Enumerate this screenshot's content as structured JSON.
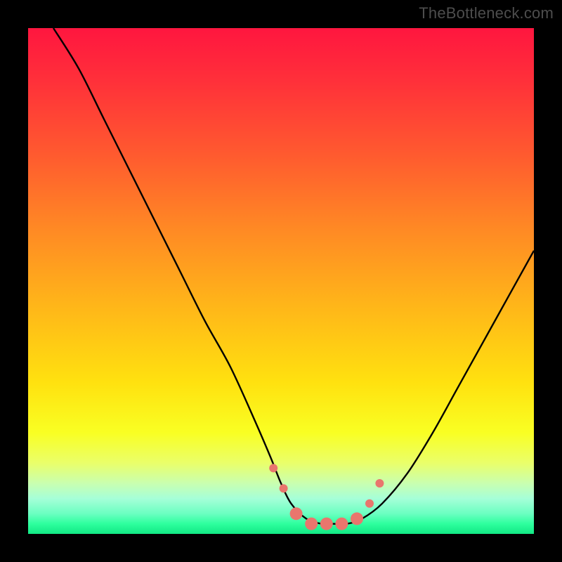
{
  "watermark": "TheBottleneck.com",
  "chart_data": {
    "type": "line",
    "title": "",
    "xlabel": "",
    "ylabel": "",
    "xlim": [
      0,
      100
    ],
    "ylim": [
      0,
      100
    ],
    "grid": false,
    "series": [
      {
        "name": "bottleneck-curve",
        "color": "#000000",
        "x": [
          5,
          10,
          15,
          20,
          25,
          30,
          35,
          40,
          45,
          48,
          50,
          52,
          55,
          58,
          60,
          63,
          66,
          70,
          75,
          80,
          85,
          90,
          95,
          100
        ],
        "y": [
          100,
          92,
          82,
          72,
          62,
          52,
          42,
          33,
          22,
          15,
          10,
          6,
          3,
          2,
          2,
          2,
          3,
          6,
          12,
          20,
          29,
          38,
          47,
          56
        ]
      }
    ],
    "markers": {
      "name": "highlight-dots",
      "color": "#e9766d",
      "radius_small": 6,
      "radius_large": 9,
      "points": [
        {
          "x": 48.5,
          "y": 13,
          "r": "small"
        },
        {
          "x": 50.5,
          "y": 9,
          "r": "small"
        },
        {
          "x": 53.0,
          "y": 4,
          "r": "large"
        },
        {
          "x": 56.0,
          "y": 2,
          "r": "large"
        },
        {
          "x": 59.0,
          "y": 2,
          "r": "large"
        },
        {
          "x": 62.0,
          "y": 2,
          "r": "large"
        },
        {
          "x": 65.0,
          "y": 3,
          "r": "large"
        },
        {
          "x": 67.5,
          "y": 6,
          "r": "small"
        },
        {
          "x": 69.5,
          "y": 10,
          "r": "small"
        }
      ]
    },
    "gradient_stops": [
      {
        "pos": 0,
        "color": "#ff163f"
      },
      {
        "pos": 25,
        "color": "#ff5a2f"
      },
      {
        "pos": 55,
        "color": "#ffb619"
      },
      {
        "pos": 80,
        "color": "#f9ff23"
      },
      {
        "pos": 95,
        "color": "#6bffc1"
      },
      {
        "pos": 100,
        "color": "#12e884"
      }
    ]
  }
}
